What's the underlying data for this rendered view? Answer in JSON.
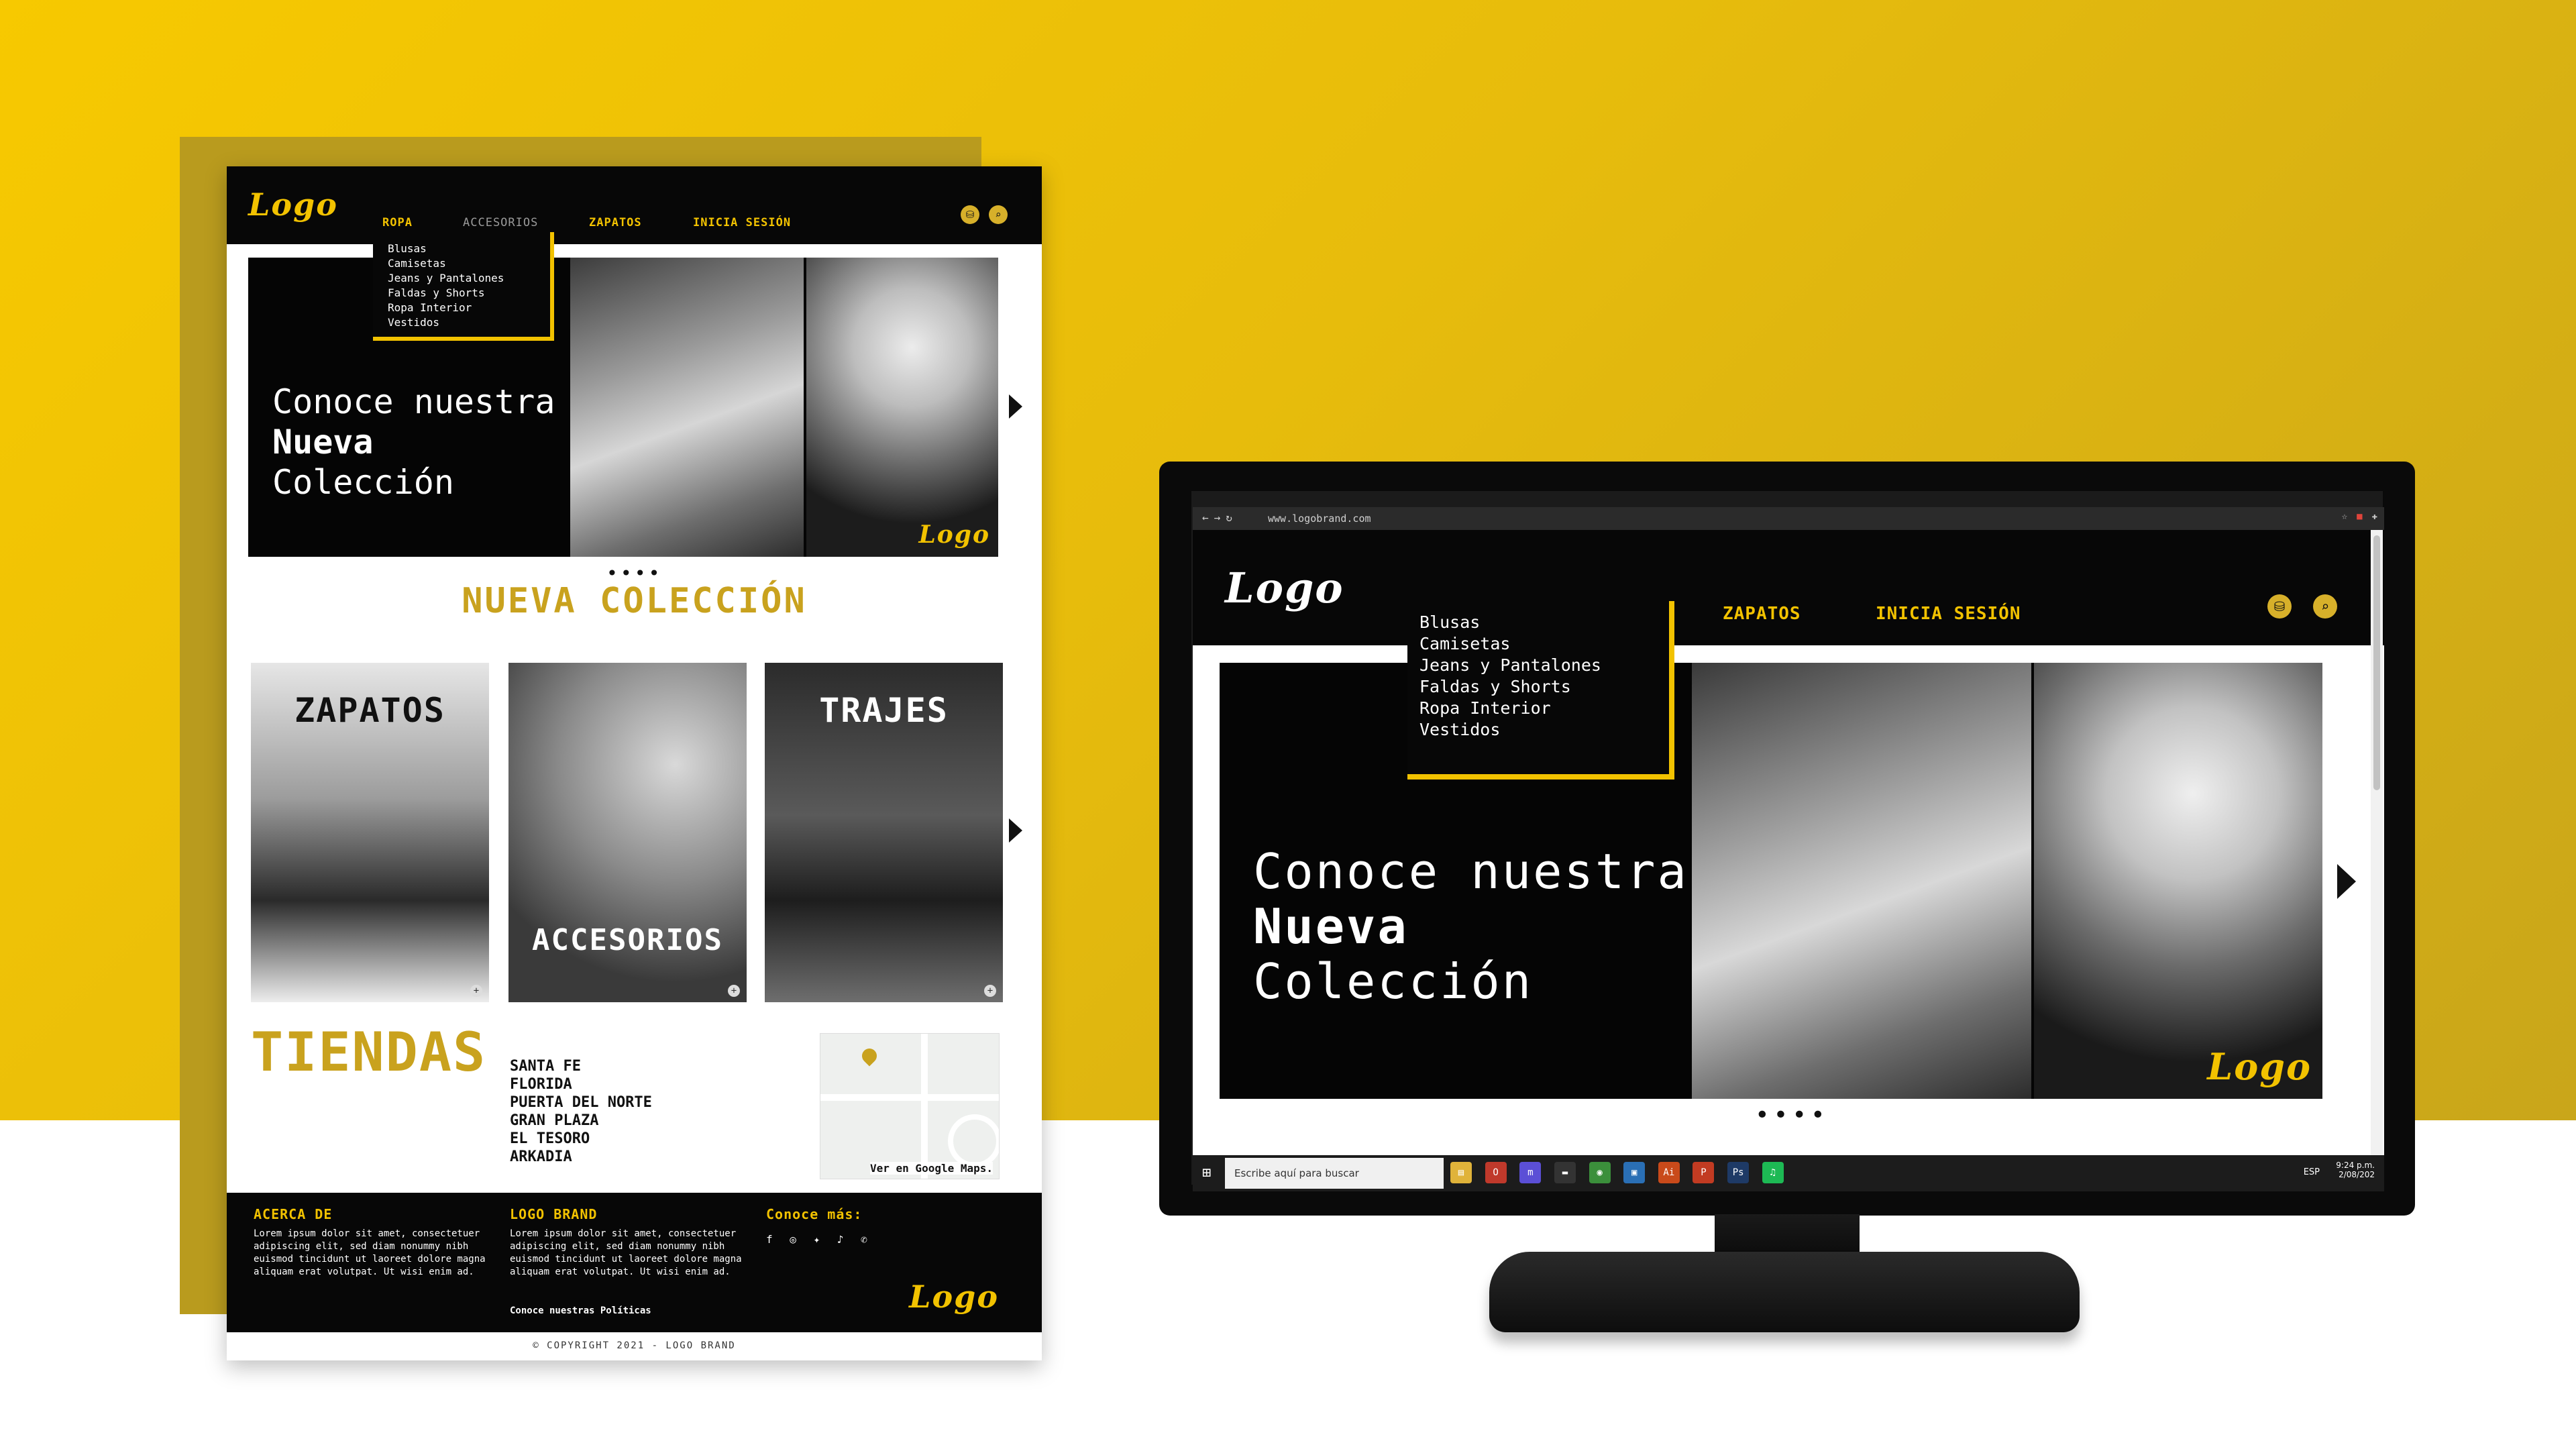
{
  "colors": {
    "brand_yellow": "#f2c200",
    "brand_gold": "#c9a21e",
    "header_black": "#070707",
    "background_gradient_start": "#f7c900",
    "background_gradient_end": "#c9a61a"
  },
  "brand": {
    "logo_text": "Logo"
  },
  "nav": {
    "items": [
      "ROPA",
      "ACCESORIOS",
      "ZAPATOS",
      "INICIA SESIÓN"
    ],
    "active": "ROPA",
    "dropdown": [
      "Blusas",
      "Camisetas",
      "Jeans y Pantalones",
      "Faldas y Shorts",
      "Ropa Interior",
      "Vestidos"
    ],
    "icons": [
      "cart-icon",
      "search-icon"
    ]
  },
  "hero": {
    "line1": "Conoce nuestra",
    "line2": "Nueva",
    "line3": "Colección",
    "dots": "••••"
  },
  "collection": {
    "title": "NUEVA COLECCIÓN",
    "cards": [
      "ZAPATOS",
      "ACCESORIOS",
      "TRAJES"
    ],
    "plus_icon": "+"
  },
  "stores": {
    "title": "TIENDAS",
    "list": [
      "SANTA FE",
      "FLORIDA",
      "PUERTA DEL NORTE",
      "GRAN PLAZA",
      "EL TESORO",
      "ARKADIA"
    ],
    "map_link": "Ver en Google Maps."
  },
  "footer": {
    "about_title": "ACERCA DE",
    "about_text": "Lorem ipsum dolor sit amet, consectetuer adipiscing elit, sed diam nonummy nibh euismod tincidunt ut laoreet dolore magna aliquam erat volutpat. Ut wisi enim ad.",
    "brand_title": "LOGO BRAND",
    "brand_text": "Lorem ipsum dolor sit amet, consectetuer adipiscing elit, sed diam nonummy nibh euismod tincidunt ut laoreet dolore magna aliquam erat volutpat. Ut wisi enim ad.",
    "policies_link": "Conoce nuestras Políticas",
    "more_title": "Conoce más:",
    "social_icons": [
      "facebook-icon",
      "instagram-icon",
      "twitter-icon",
      "tiktok-icon",
      "whatsapp-icon"
    ],
    "copyright": "© COPYRIGHT 2021 - LOGO BRAND"
  },
  "browser": {
    "url": "www.logobrand.com"
  },
  "taskbar": {
    "search_placeholder": "Escribe aquí para buscar",
    "language": "ESP",
    "time": "9:24 p.m.",
    "date": "2/08/202"
  }
}
